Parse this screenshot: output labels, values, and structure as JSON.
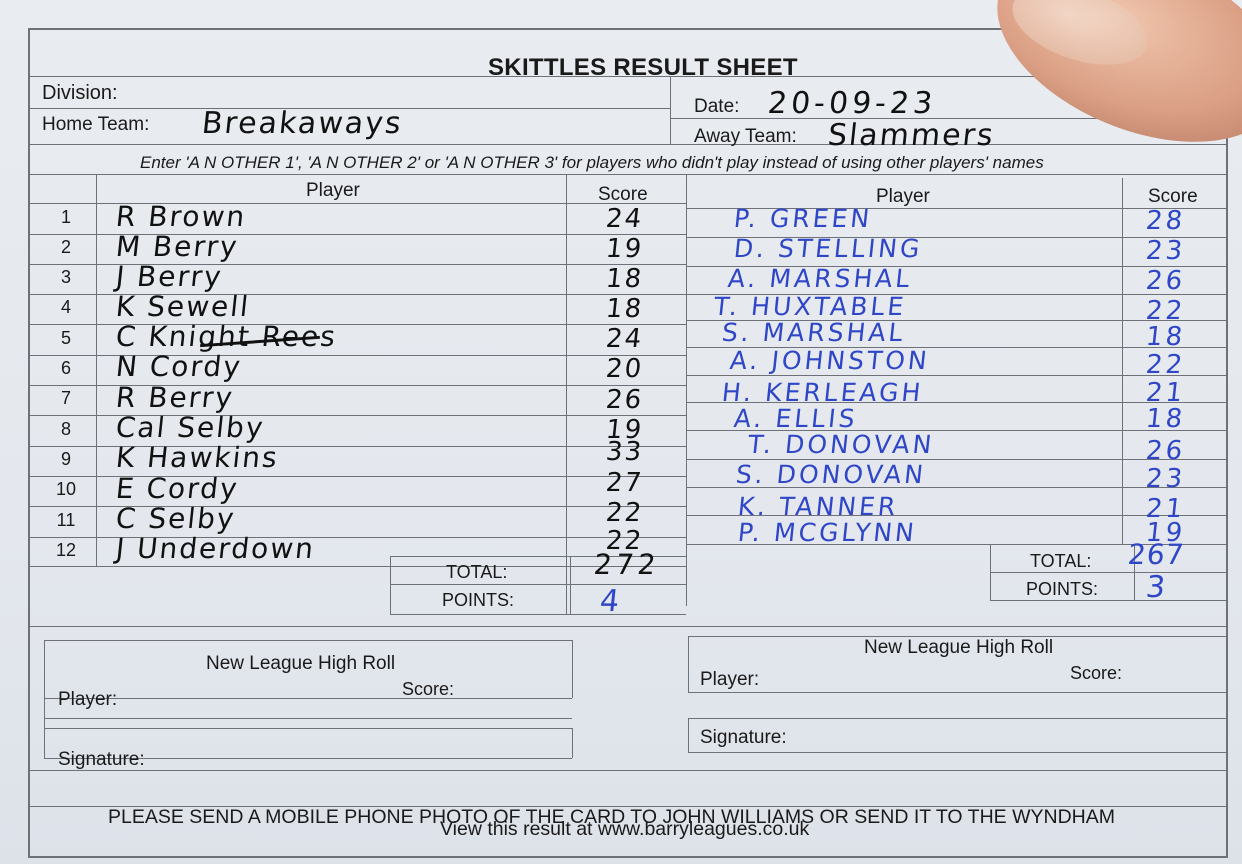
{
  "sheet": {
    "title": "SKITTLES RESULT SHEET",
    "division_label": "Division:",
    "home_team_label": "Home Team:",
    "home_team_value": "Breakaways",
    "date_label": "Date:",
    "date_value": "20-09-23",
    "away_team_label": "Away Team:",
    "away_team_value": "Slammers",
    "instruction": "Enter 'A N OTHER 1', 'A N OTHER 2' or 'A N OTHER 3' for players who didn't play instead of using other players' names"
  },
  "table": {
    "player_header": "Player",
    "score_header": "Score",
    "row_numbers": [
      "1",
      "2",
      "3",
      "4",
      "5",
      "6",
      "7",
      "8",
      "9",
      "10",
      "11",
      "12"
    ],
    "home_rows": [
      {
        "player": "R  Brown",
        "score": "24"
      },
      {
        "player": "M  Berry",
        "score": "19"
      },
      {
        "player": "J  Berry",
        "score": "18"
      },
      {
        "player": "K  Sewell",
        "score": "18"
      },
      {
        "player": "C  Knight  Rees",
        "score": "24"
      },
      {
        "player": "N  Cordy",
        "score": "20"
      },
      {
        "player": "R  Berry",
        "score": "26"
      },
      {
        "player": "Cal  Selby",
        "score": "19"
      },
      {
        "player": "K  Hawkins",
        "score": "33"
      },
      {
        "player": "E  Cordy",
        "score": "27"
      },
      {
        "player": "C  Selby",
        "score": "22"
      },
      {
        "player": "J  Underdown",
        "score": "22"
      }
    ],
    "away_rows": [
      {
        "player": "P. GREEN",
        "score": "28"
      },
      {
        "player": "D. STELLING",
        "score": "23"
      },
      {
        "player": "A. MARSHAL",
        "score": "26"
      },
      {
        "player": "T. HUXTABLE",
        "score": "22"
      },
      {
        "player": "S. MARSHAL",
        "score": "18"
      },
      {
        "player": "A. JOHNSTON",
        "score": "22"
      },
      {
        "player": "H. KERLEAGH",
        "score": "21"
      },
      {
        "player": "A. ELLIS",
        "score": "18"
      },
      {
        "player": "T. DONOVAN",
        "score": "26"
      },
      {
        "player": "S. DONOVAN",
        "score": "23"
      },
      {
        "player": "K. TANNER",
        "score": "21"
      },
      {
        "player": "P. MCGLYNN",
        "score": "19"
      }
    ],
    "total_label": "TOTAL:",
    "points_label": "POINTS:",
    "home_total": "272",
    "home_points": "4",
    "away_total": "267",
    "away_points": "3"
  },
  "high_roll": {
    "title": "New League High Roll",
    "player_label": "Player:",
    "score_label": "Score:",
    "signature_label": "Signature:"
  },
  "footer": {
    "line1": "PLEASE SEND A MOBILE PHONE PHOTO OF THE CARD TO JOHN WILLIAMS OR SEND IT TO THE WYNDHAM",
    "line2": "View this result at www.barryleagues.co.uk"
  },
  "colors": {
    "paper": "#e6e9ee",
    "rule": "#6e7278",
    "ink_black": "#111111",
    "ink_blue": "#2f47c7"
  }
}
